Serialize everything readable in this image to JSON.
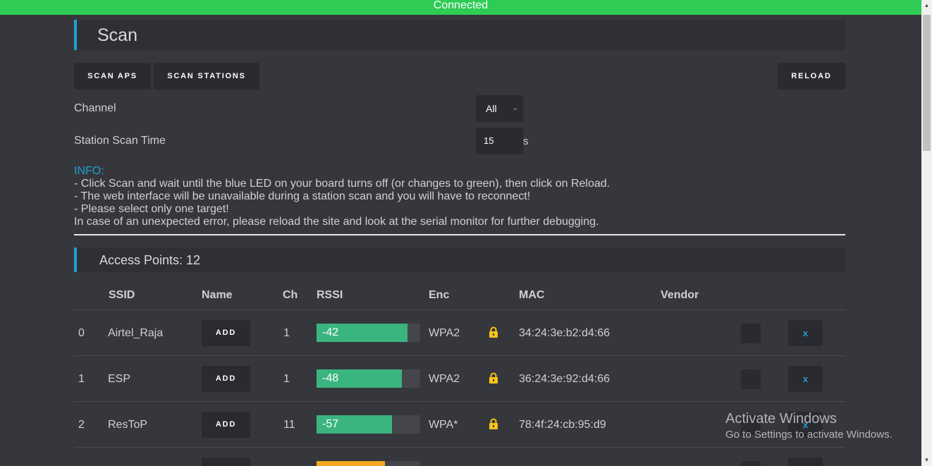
{
  "status": {
    "text": "Connected",
    "color": "#2ecc55"
  },
  "page": {
    "title": "Scan",
    "accent": "#1ea0d3"
  },
  "toolbar": {
    "scan_aps": "SCAN APS",
    "scan_stations": "SCAN STATIONS",
    "reload": "RELOAD"
  },
  "settings": {
    "channel_label": "Channel",
    "channel_value": "All",
    "scan_time_label": "Station Scan Time",
    "scan_time_value": "15",
    "scan_time_unit": "s"
  },
  "info": {
    "heading": "INFO:",
    "lines": [
      "- Click Scan and wait until the blue LED on your board turns off (or changes to green), then click on Reload.",
      "- The web interface will be unavailable during a station scan and you will have to reconnect!",
      "- Please select only one target!",
      "In case of an unexpected error, please reload the site and look at the serial monitor for further debugging."
    ]
  },
  "access_points": {
    "header": "Access Points: 12",
    "columns": [
      "SSID",
      "Name",
      "Ch",
      "RSSI",
      "Enc",
      "MAC",
      "Vendor"
    ],
    "add_label": "ADD",
    "remove_label": "x",
    "rows": [
      {
        "index": "0",
        "ssid": "Airtel_Raja",
        "ch": "1",
        "rssi": "-42",
        "rssi_level": 0.88,
        "enc": "WPA2",
        "mac": "34:24:3e:b2:d4:66",
        "vendor": ""
      },
      {
        "index": "1",
        "ssid": "ESP",
        "ch": "1",
        "rssi": "-48",
        "rssi_level": 0.82,
        "enc": "WPA2",
        "mac": "36:24:3e:92:d4:66",
        "vendor": ""
      },
      {
        "index": "2",
        "ssid": "ResToP",
        "ch": "11",
        "rssi": "-57",
        "rssi_level": 0.73,
        "enc": "WPA*",
        "mac": "78:4f:24:cb:95:d9",
        "vendor": ""
      }
    ]
  },
  "watermark": {
    "title": "Activate Windows",
    "subtitle": "Go to Settings to activate Windows."
  },
  "colors": {
    "rssi_good": "#3bb580",
    "rssi_mid": "#f5a623",
    "lock": "#f5c518"
  }
}
